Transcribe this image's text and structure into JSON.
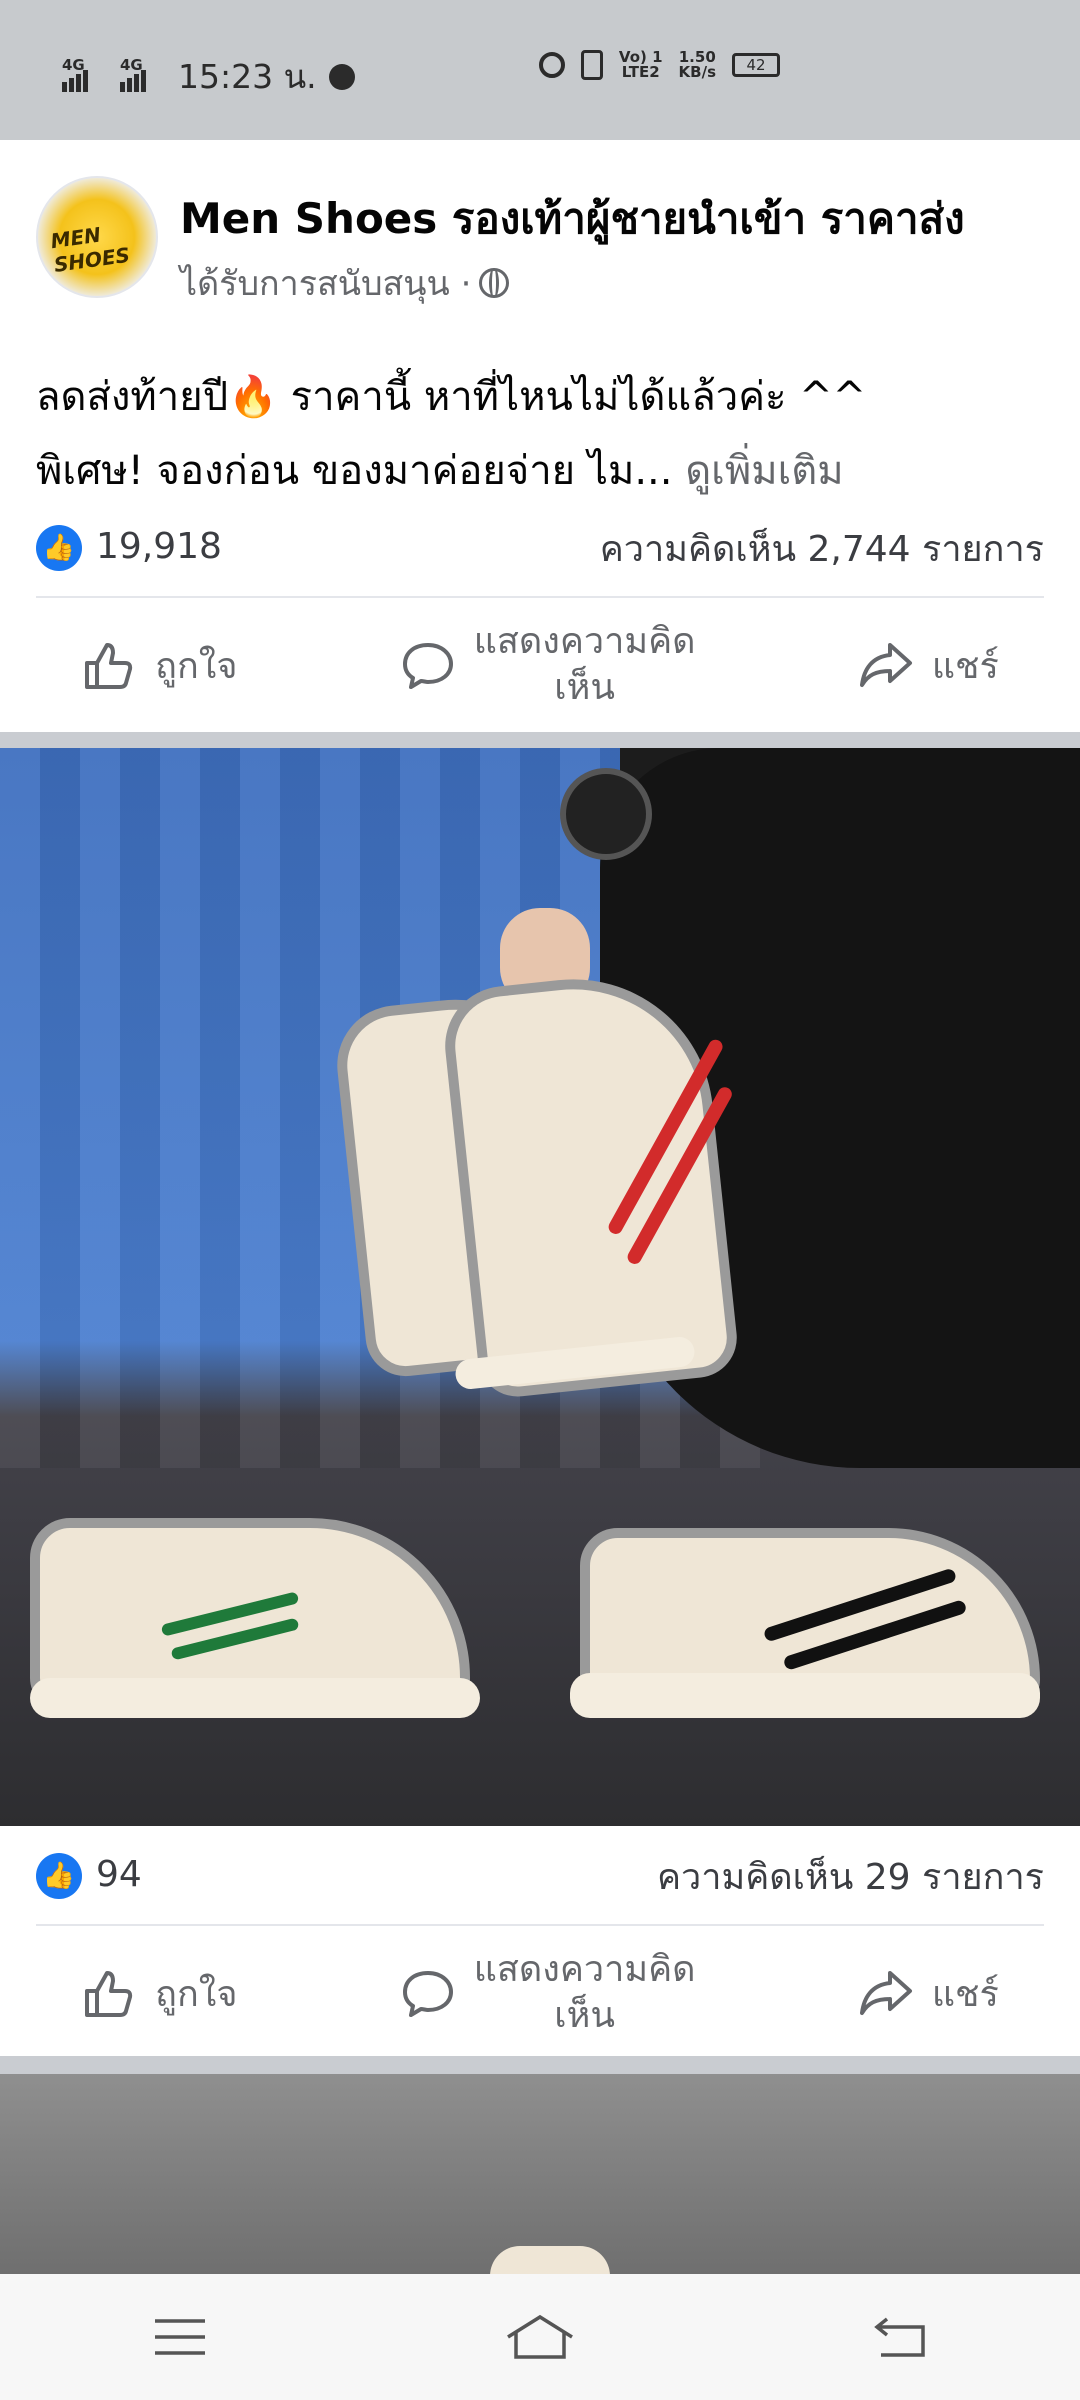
{
  "status_bar": {
    "net1": "4G",
    "net2": "4G",
    "time": "15:23 น.",
    "volte": "Vo) 1",
    "lte": "LTE2",
    "speed_value": "1.50",
    "speed_unit": "KB/s",
    "battery": "42"
  },
  "post": {
    "avatar_text": "MEN SHOES",
    "page_name": "Men Shoes รองเท้าผู้ชายนำเข้า ราคาส่ง",
    "sponsored": "ได้รับการสนับสนุน ·",
    "text_line1": "ลดส่งท้ายปี🔥 ราคานี้ หาที่ไหนไม่ได้แล้วค่ะ ^^",
    "text_line2": "พิเศษ! จองก่อน ของมาค่อยจ่าย ไม...",
    "see_more": "ดูเพิ่มเติม",
    "reactions": "19,918",
    "comments": "ความคิดเห็น 2,744 รายการ",
    "like": "ถูกใจ",
    "comment_l1": "แสดงความคิด",
    "comment_l2": "เห็น",
    "share": "แชร์"
  },
  "photo_stats": {
    "reactions": "94",
    "comments": "ความคิดเห็น 29 รายการ",
    "like": "ถูกใจ",
    "comment_l1": "แสดงความคิด",
    "comment_l2": "เห็น",
    "share": "แชร์"
  },
  "icons": [
    "messenger-icon",
    "alarm-icon",
    "vibrate-icon",
    "globe-icon",
    "like-icon",
    "comment-icon",
    "share-icon",
    "menu-icon",
    "home-icon",
    "back-icon"
  ]
}
